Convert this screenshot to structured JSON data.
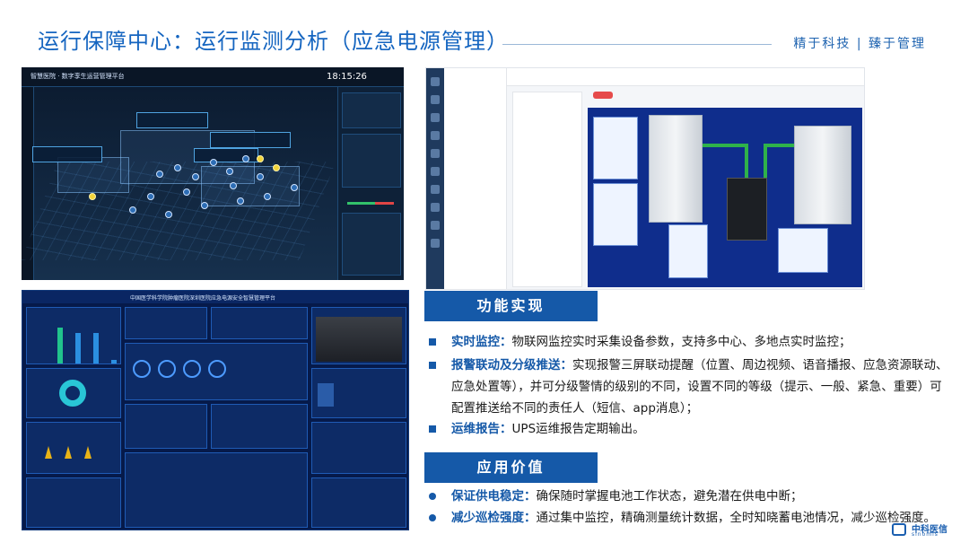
{
  "header": {
    "title": "运行保障中心：运行监测分析（应急电源管理）",
    "slogan": "精于科技 | 臻于管理"
  },
  "screenshots": {
    "three_d": {
      "title": "智慧医院 · 数字孪生运营管理平台",
      "time": "18:15:26"
    },
    "dashboard": {
      "title": "中国医学科学院肿瘤医院深圳医院应急电源安全智慧管理平台"
    }
  },
  "features": {
    "header": "功能实现",
    "items": [
      {
        "label": "实时监控：",
        "text": "物联网监控实时采集设备参数，支持多中心、多地点实时监控；"
      },
      {
        "label": "报警联动及分级推送：",
        "text": "实现报警三屏联动提醒（位置、周边视频、语音播报、应急资源联动、应急处置等），并可分级警情的级别的不同，设置不同的等级（提示、一般、紧急、重要）可配置推送给不同的责任人（短信、app消息）；"
      },
      {
        "label": "运维报告：",
        "text": "UPS运维报告定期输出。"
      }
    ]
  },
  "values": {
    "header": "应用价值",
    "items": [
      {
        "label": "保证供电稳定：",
        "text": "确保随时掌握电池工作状态，避免潜在供电中断；"
      },
      {
        "label": "减少巡检强度：",
        "text": "通过集中监控，精确测量统计数据，全时知晓蓄电池情况，减少巡检强度。"
      }
    ]
  },
  "logo": {
    "name": "中科医信",
    "sub": "sinomis"
  },
  "colors": {
    "primary": "#1559a8",
    "title": "#1565c0"
  }
}
